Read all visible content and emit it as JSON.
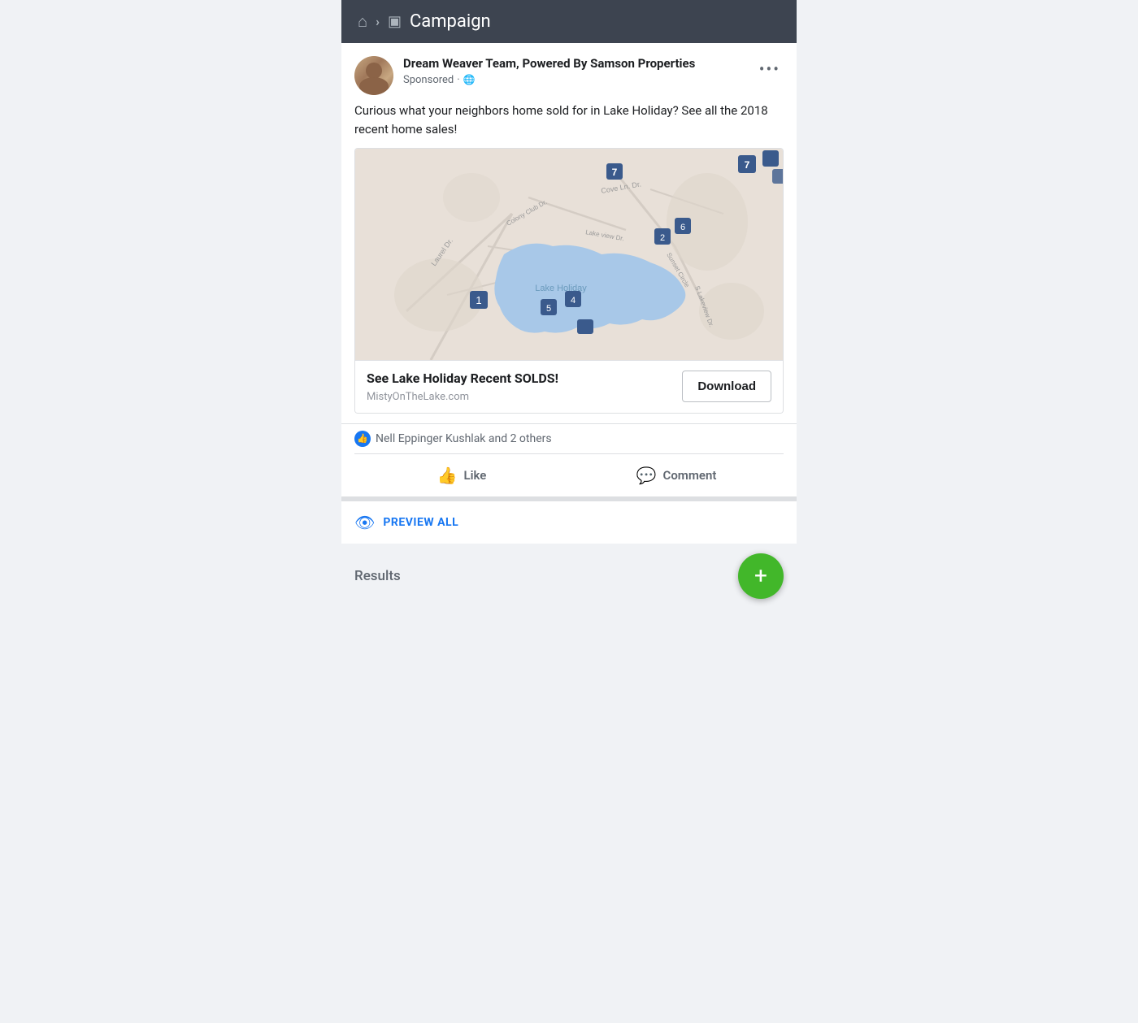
{
  "header": {
    "title": "Campaign",
    "home_icon": "🏠",
    "chevron": "›",
    "folder_icon": "📁"
  },
  "post": {
    "author": "Dream Weaver Team, Powered By Samson Properties",
    "sponsored_label": "Sponsored",
    "options_icon": "•••",
    "post_text": "Curious what your neighbors home sold for in Lake Holiday? See all the 2018 recent home sales!",
    "ad_card": {
      "title": "See Lake Holiday Recent SOLDS!",
      "url": "MistyOnTheLake.com",
      "download_label": "Download"
    },
    "reactions": {
      "text": "Nell Eppinger Kushlak and 2 others"
    },
    "actions": {
      "like_label": "Like",
      "comment_label": "Comment"
    }
  },
  "preview_all": {
    "label": "PREVIEW ALL"
  },
  "results": {
    "label": "Results",
    "fab_icon": "+"
  },
  "colors": {
    "header_bg": "#3d4450",
    "primary_blue": "#1877f2",
    "fab_green": "#42b72a",
    "text_dark": "#1c1e21",
    "text_gray": "#606770",
    "border": "#dddfe2",
    "map_water": "#a8c8e8",
    "map_land": "#e8e0d8"
  }
}
